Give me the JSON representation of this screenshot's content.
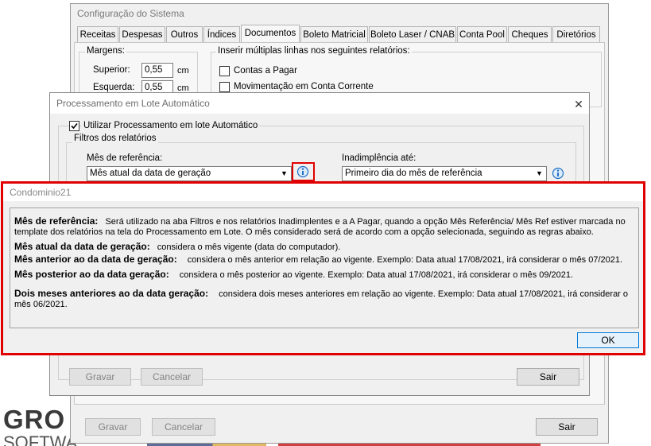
{
  "config_window": {
    "title": "Configuração do Sistema",
    "tabs": [
      "Receitas",
      "Despesas",
      "Outros",
      "Índices",
      "Documentos",
      "Boleto Matricial",
      "Boleto Laser / CNAB",
      "Conta Pool",
      "Cheques",
      "Diretórios"
    ],
    "active_tab": "Documentos",
    "margins_label": "Margens:",
    "top_label": "Superior:",
    "top_value": "0,55",
    "left_label": "Esquerda:",
    "left_value": "0,55",
    "unit": "cm",
    "multi_lines_label": "Inserir múltiplas linhas nos seguintes relatórios:",
    "checkbox_accounts_payable": "Contas a Pagar",
    "checkbox_checking_account": "Movimentação em Conta Corrente",
    "btn_save": "Gravar",
    "btn_cancel": "Cancelar",
    "btn_exit": "Sair"
  },
  "batch_window": {
    "title": "Processamento em Lote Automático",
    "close_glyph": "✕",
    "use_batch_label": "Utilizar Processamento em lote Automático",
    "use_batch_checked": true,
    "filters_label": "Filtros dos relatórios",
    "ref_month_label": "Mês de referência:",
    "ref_month_value": "Mês atual da data de geração",
    "default_label": "Inadimplência até:",
    "default_value": "Primeiro dia do mês de referência",
    "btn_save": "Gravar",
    "btn_cancel": "Cancelar",
    "btn_exit": "Sair"
  },
  "help_dialog": {
    "title": "Condominio21",
    "intro_heading": "Mês de referência:",
    "intro_text_1": "Será utilizado na aba Filtros e nos relatórios Inadimplentes e a A Pagar, quando a opção Mês Referência/ Mês Ref estiver marcada no",
    "intro_text_2": "template dos relatórios na tela do Processamento em Lote. O mês considerado será de acordo com a opção selecionada, seguindo as regras abaixo.",
    "opt1_heading": "Mês atual da data de geração:",
    "opt1_text": "considera o mês vigente (data do computador).",
    "opt2_heading": "Mês anterior ao da data de geração:",
    "opt2_text": "considera o mês anterior em relação ao vigente. Exemplo: Data atual 17/08/2021, irá considerar o mês 07/2021.",
    "opt3_heading": "Mês posterior ao da data geração:",
    "opt3_text": "considera o mês posterior ao vigente. Exemplo: Data atual 17/08/2021, irá considerar o mês 09/2021.",
    "opt4_heading": "Dois meses anteriores ao da data geração:",
    "opt4_text_1": "considera dois meses anteriores em relação ao vigente. Exemplo: Data atual 17/08/2021, irá considerar o",
    "opt4_text_2": "mês 06/2021.",
    "ok_label": "OK"
  },
  "background_logo": {
    "text_1": "GRO",
    "text_2": "SOFTWA"
  },
  "colors": {
    "highlight": "#e00000",
    "window_bg": "#f0f0f0",
    "info_icon": "#1f6fc5"
  },
  "icons": {
    "info": "info-icon",
    "close": "close-icon",
    "dropdown": "chevron-down-icon",
    "checkmark": "checkmark-icon"
  }
}
